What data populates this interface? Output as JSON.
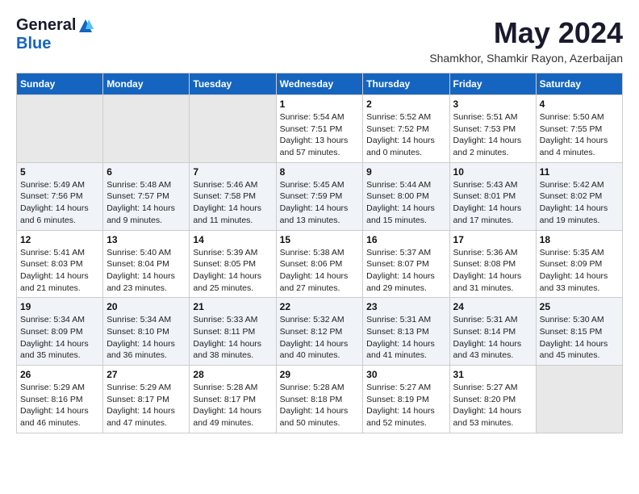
{
  "header": {
    "logo_general": "General",
    "logo_blue": "Blue",
    "month_year": "May 2024",
    "location": "Shamkhor, Shamkir Rayon, Azerbaijan"
  },
  "days_of_week": [
    "Sunday",
    "Monday",
    "Tuesday",
    "Wednesday",
    "Thursday",
    "Friday",
    "Saturday"
  ],
  "weeks": [
    [
      {
        "day": "",
        "info": ""
      },
      {
        "day": "",
        "info": ""
      },
      {
        "day": "",
        "info": ""
      },
      {
        "day": "1",
        "info": "Sunrise: 5:54 AM\nSunset: 7:51 PM\nDaylight: 13 hours\nand 57 minutes."
      },
      {
        "day": "2",
        "info": "Sunrise: 5:52 AM\nSunset: 7:52 PM\nDaylight: 14 hours\nand 0 minutes."
      },
      {
        "day": "3",
        "info": "Sunrise: 5:51 AM\nSunset: 7:53 PM\nDaylight: 14 hours\nand 2 minutes."
      },
      {
        "day": "4",
        "info": "Sunrise: 5:50 AM\nSunset: 7:55 PM\nDaylight: 14 hours\nand 4 minutes."
      }
    ],
    [
      {
        "day": "5",
        "info": "Sunrise: 5:49 AM\nSunset: 7:56 PM\nDaylight: 14 hours\nand 6 minutes."
      },
      {
        "day": "6",
        "info": "Sunrise: 5:48 AM\nSunset: 7:57 PM\nDaylight: 14 hours\nand 9 minutes."
      },
      {
        "day": "7",
        "info": "Sunrise: 5:46 AM\nSunset: 7:58 PM\nDaylight: 14 hours\nand 11 minutes."
      },
      {
        "day": "8",
        "info": "Sunrise: 5:45 AM\nSunset: 7:59 PM\nDaylight: 14 hours\nand 13 minutes."
      },
      {
        "day": "9",
        "info": "Sunrise: 5:44 AM\nSunset: 8:00 PM\nDaylight: 14 hours\nand 15 minutes."
      },
      {
        "day": "10",
        "info": "Sunrise: 5:43 AM\nSunset: 8:01 PM\nDaylight: 14 hours\nand 17 minutes."
      },
      {
        "day": "11",
        "info": "Sunrise: 5:42 AM\nSunset: 8:02 PM\nDaylight: 14 hours\nand 19 minutes."
      }
    ],
    [
      {
        "day": "12",
        "info": "Sunrise: 5:41 AM\nSunset: 8:03 PM\nDaylight: 14 hours\nand 21 minutes."
      },
      {
        "day": "13",
        "info": "Sunrise: 5:40 AM\nSunset: 8:04 PM\nDaylight: 14 hours\nand 23 minutes."
      },
      {
        "day": "14",
        "info": "Sunrise: 5:39 AM\nSunset: 8:05 PM\nDaylight: 14 hours\nand 25 minutes."
      },
      {
        "day": "15",
        "info": "Sunrise: 5:38 AM\nSunset: 8:06 PM\nDaylight: 14 hours\nand 27 minutes."
      },
      {
        "day": "16",
        "info": "Sunrise: 5:37 AM\nSunset: 8:07 PM\nDaylight: 14 hours\nand 29 minutes."
      },
      {
        "day": "17",
        "info": "Sunrise: 5:36 AM\nSunset: 8:08 PM\nDaylight: 14 hours\nand 31 minutes."
      },
      {
        "day": "18",
        "info": "Sunrise: 5:35 AM\nSunset: 8:09 PM\nDaylight: 14 hours\nand 33 minutes."
      }
    ],
    [
      {
        "day": "19",
        "info": "Sunrise: 5:34 AM\nSunset: 8:09 PM\nDaylight: 14 hours\nand 35 minutes."
      },
      {
        "day": "20",
        "info": "Sunrise: 5:34 AM\nSunset: 8:10 PM\nDaylight: 14 hours\nand 36 minutes."
      },
      {
        "day": "21",
        "info": "Sunrise: 5:33 AM\nSunset: 8:11 PM\nDaylight: 14 hours\nand 38 minutes."
      },
      {
        "day": "22",
        "info": "Sunrise: 5:32 AM\nSunset: 8:12 PM\nDaylight: 14 hours\nand 40 minutes."
      },
      {
        "day": "23",
        "info": "Sunrise: 5:31 AM\nSunset: 8:13 PM\nDaylight: 14 hours\nand 41 minutes."
      },
      {
        "day": "24",
        "info": "Sunrise: 5:31 AM\nSunset: 8:14 PM\nDaylight: 14 hours\nand 43 minutes."
      },
      {
        "day": "25",
        "info": "Sunrise: 5:30 AM\nSunset: 8:15 PM\nDaylight: 14 hours\nand 45 minutes."
      }
    ],
    [
      {
        "day": "26",
        "info": "Sunrise: 5:29 AM\nSunset: 8:16 PM\nDaylight: 14 hours\nand 46 minutes."
      },
      {
        "day": "27",
        "info": "Sunrise: 5:29 AM\nSunset: 8:17 PM\nDaylight: 14 hours\nand 47 minutes."
      },
      {
        "day": "28",
        "info": "Sunrise: 5:28 AM\nSunset: 8:17 PM\nDaylight: 14 hours\nand 49 minutes."
      },
      {
        "day": "29",
        "info": "Sunrise: 5:28 AM\nSunset: 8:18 PM\nDaylight: 14 hours\nand 50 minutes."
      },
      {
        "day": "30",
        "info": "Sunrise: 5:27 AM\nSunset: 8:19 PM\nDaylight: 14 hours\nand 52 minutes."
      },
      {
        "day": "31",
        "info": "Sunrise: 5:27 AM\nSunset: 8:20 PM\nDaylight: 14 hours\nand 53 minutes."
      },
      {
        "day": "",
        "info": ""
      }
    ]
  ]
}
